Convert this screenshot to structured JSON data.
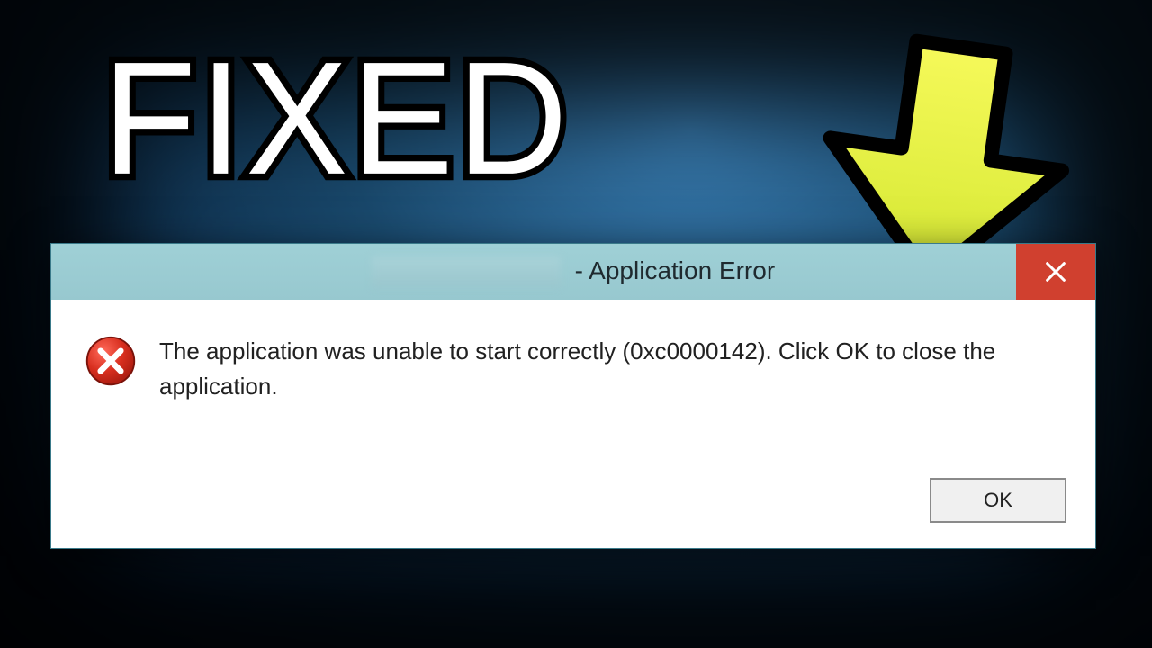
{
  "overlay": {
    "headline": "FIXED"
  },
  "dialog": {
    "title_suffix": "- Application Error",
    "message": "The application was unable to start correctly (0xc0000142). Click OK to close the application.",
    "buttons": {
      "ok": "OK"
    }
  }
}
